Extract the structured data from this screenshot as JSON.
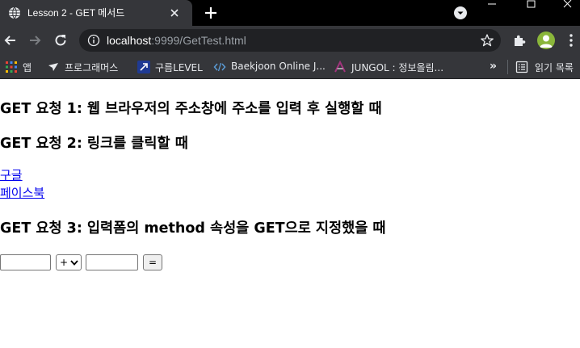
{
  "browser": {
    "tab": {
      "title": "Lesson 2 - GET 메서드"
    },
    "url": {
      "host": "localhost",
      "rest": ":9999/GetTest.html"
    },
    "bookmarks": [
      {
        "label": "앱",
        "icon": "apps-grid-icon"
      },
      {
        "label": "프로그래머스",
        "icon": "programmers-icon"
      },
      {
        "label": "구름LEVEL",
        "icon": "goorm-icon"
      },
      {
        "label": "Baekjoon Online J...",
        "icon": "code-icon"
      },
      {
        "label": "JUNGOL : 정보올림...",
        "icon": "jungol-icon"
      }
    ],
    "bookmarks_overflow": "»",
    "reading_list": "읽기 목록"
  },
  "page": {
    "heading1": "GET 요청 1: 웹 브라우저의 주소창에 주소를 입력 후 실행할 때",
    "heading2": "GET 요청 2: 링크를 클릭할 때",
    "links": [
      "구글",
      "페이스북"
    ],
    "heading3": "GET 요청 3: 입력폼의 method 속성을 GET으로 지정했을 때",
    "form": {
      "num1_value": "",
      "operator_selected": "+",
      "num2_value": "",
      "submit_label": "="
    }
  }
}
